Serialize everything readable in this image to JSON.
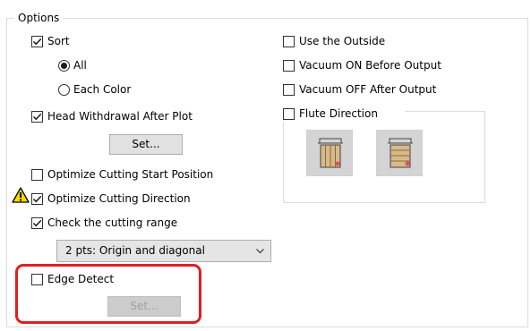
{
  "options": {
    "title": "Options",
    "sort": {
      "label": "Sort",
      "checked": true
    },
    "sort_all": {
      "label": "All",
      "selected": true
    },
    "sort_each_color": {
      "label": "Each Color",
      "selected": false
    },
    "head_withdrawal": {
      "label": "Head Withdrawal After Plot",
      "checked": true
    },
    "set_button": "Set...",
    "optimize_start": {
      "label": "Optimize Cutting Start Position",
      "checked": false
    },
    "optimize_direction": {
      "label": "Optimize Cutting Direction",
      "checked": true,
      "warning_icon": "warning-icon"
    },
    "check_range": {
      "label": "Check the cutting range",
      "checked": true
    },
    "range_select": {
      "value": "2 pts: Origin and diagonal"
    },
    "edge_detect": {
      "label": "Edge Detect",
      "checked": false
    },
    "edge_set_button": "Set...",
    "use_outside": {
      "label": "Use the Outside",
      "checked": false
    },
    "vacuum_on": {
      "label": "Vacuum ON Before Output",
      "checked": false
    },
    "vacuum_off": {
      "label": "Vacuum OFF After Output",
      "checked": false
    },
    "flute_direction": {
      "label": "Flute Direction",
      "checked": false
    }
  },
  "colors": {
    "highlight": "#e02020",
    "checkmark": "#1a1a1a",
    "warning_fill": "#ffd800",
    "flute_dot": "#e05060"
  },
  "icons": {
    "flute_vertical": "flute-vertical-icon",
    "flute_horizontal": "flute-horizontal-icon",
    "dropdown": "chevron-down-icon"
  }
}
